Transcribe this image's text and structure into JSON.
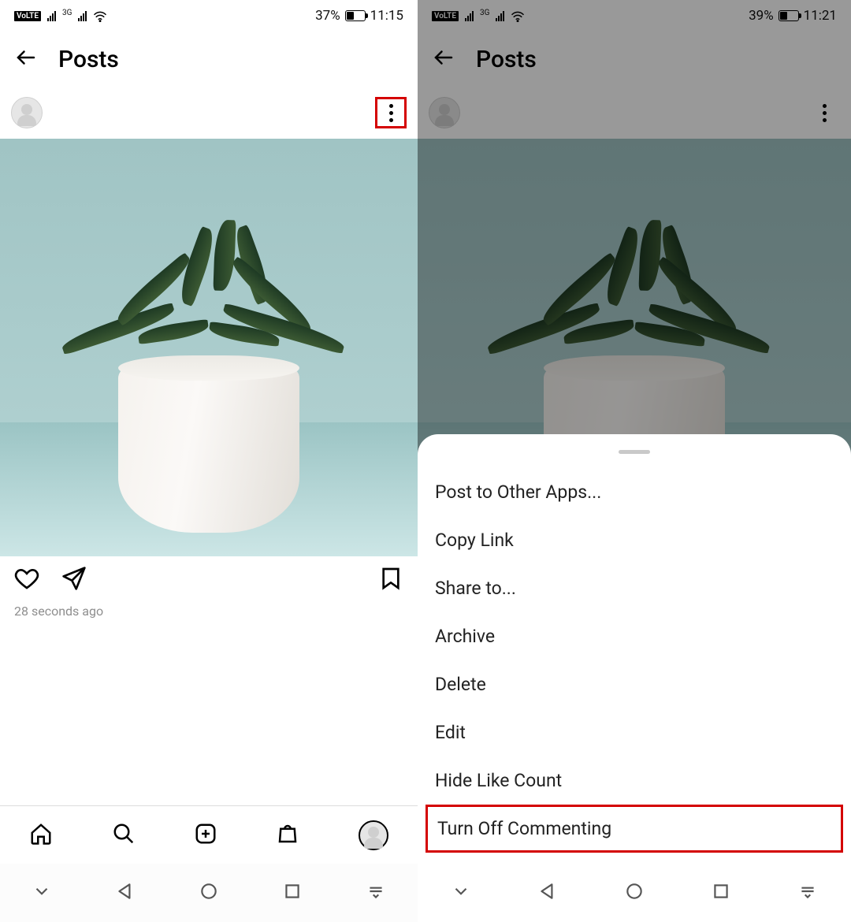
{
  "left": {
    "status": {
      "battery_pct": "37%",
      "time": "11:15"
    },
    "header": {
      "title": "Posts"
    },
    "post": {
      "timestamp": "28 seconds ago"
    }
  },
  "right": {
    "status": {
      "battery_pct": "39%",
      "time": "11:21"
    },
    "header": {
      "title": "Posts"
    },
    "sheet_items": [
      "Post to Other Apps...",
      "Copy Link",
      "Share to...",
      "Archive",
      "Delete",
      "Edit",
      "Hide Like Count",
      "Turn Off Commenting"
    ],
    "highlighted_index": 7
  }
}
